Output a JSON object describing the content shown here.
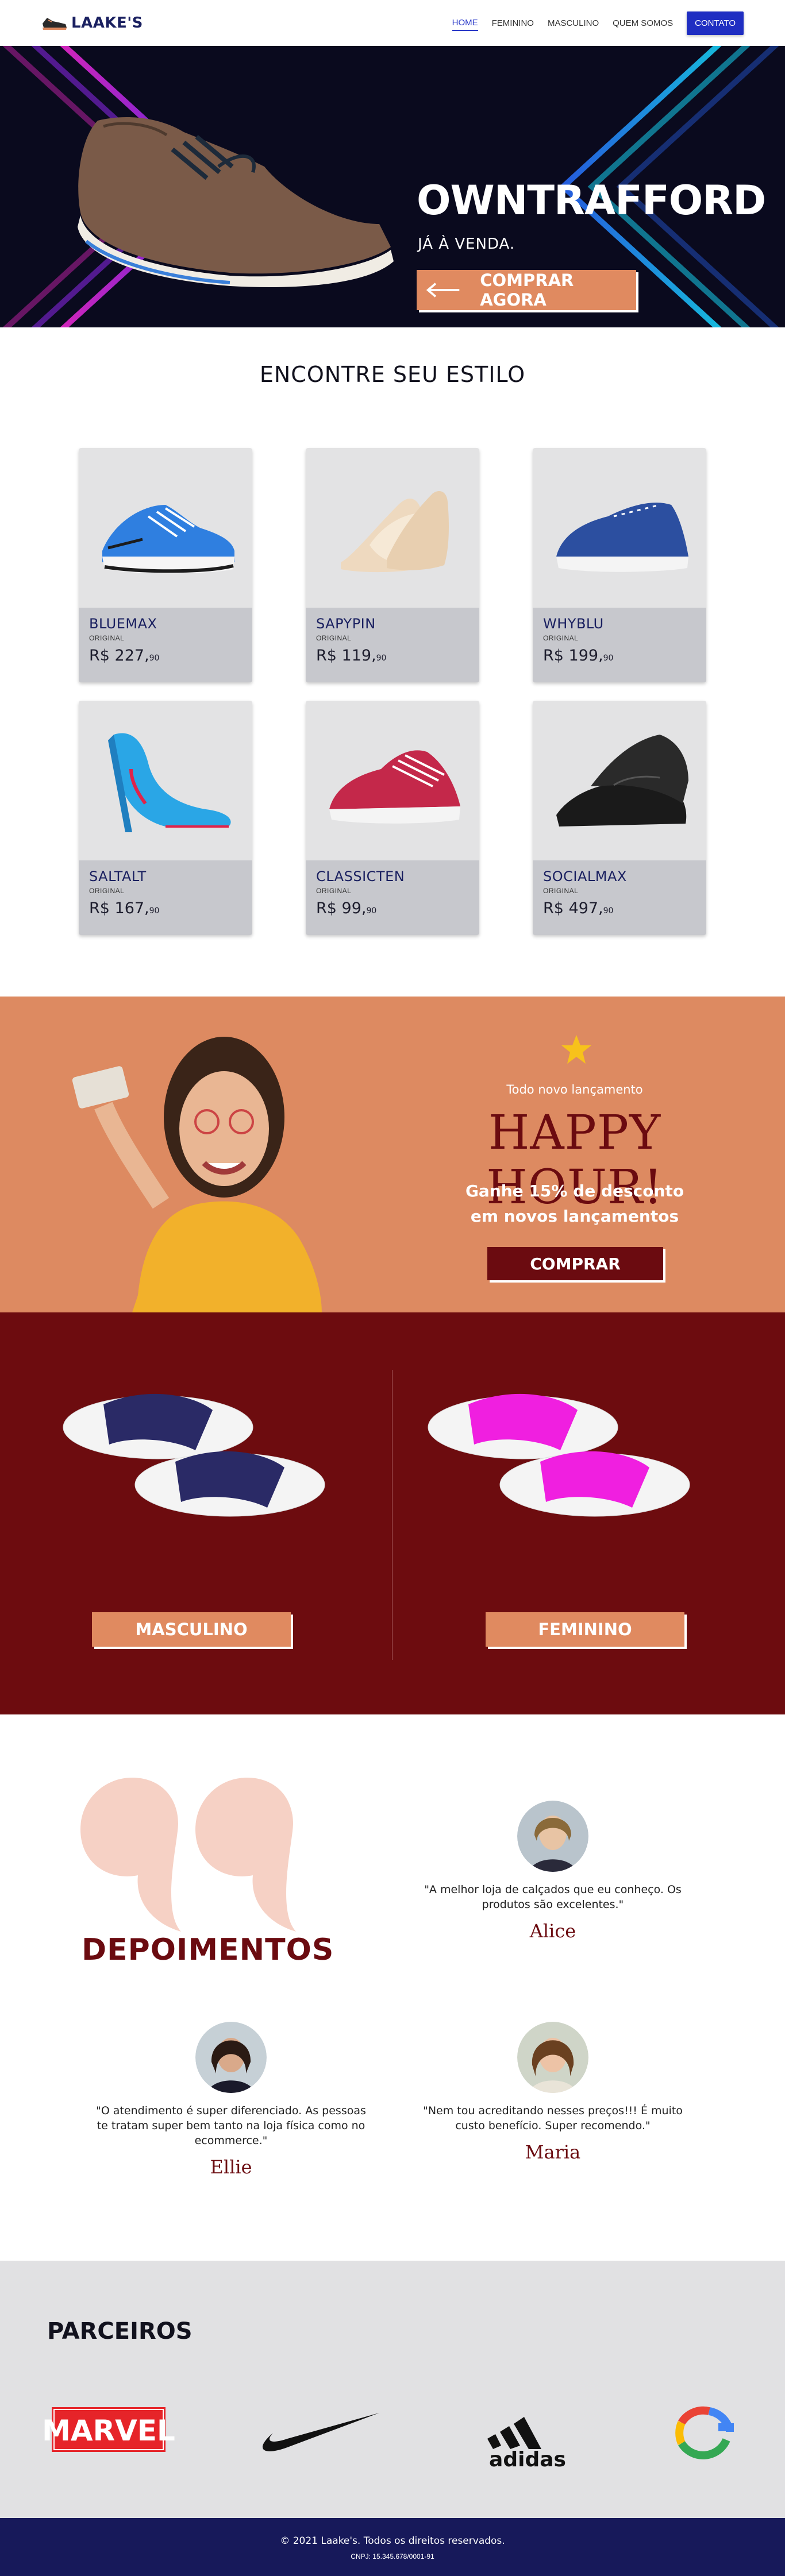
{
  "brand": {
    "name": "LAAKE'S",
    "logo_icon": "sneaker-logo-icon"
  },
  "nav": {
    "links": [
      {
        "label": "HOME",
        "active": true
      },
      {
        "label": "FEMININO"
      },
      {
        "label": "MASCULINO"
      },
      {
        "label": "QUEM SOMOS"
      }
    ],
    "contact_label": "CONTATO",
    "accent_color": "#1f2ec2"
  },
  "hero": {
    "title": "OWNTRAFFORD",
    "subtitle": "JÁ À VENDA.",
    "cta_label": "COMPRAR AGORA",
    "cta_icon": "arrow-left-icon",
    "cta_color": "#e08a60"
  },
  "style_section": {
    "title": "ENCONTRE SEU ESTILO",
    "products": [
      {
        "name": "BLUEMAX",
        "tag": "ORIGINAL",
        "price": "R$ 227,",
        "cents": "90",
        "image": "blue-sneaker"
      },
      {
        "name": "SAPYPIN",
        "tag": "ORIGINAL",
        "price": "R$ 119,",
        "cents": "90",
        "image": "beige-flat"
      },
      {
        "name": "WHYBLU",
        "tag": "ORIGINAL",
        "price": "R$ 199,",
        "cents": "90",
        "image": "navy-canvas"
      },
      {
        "name": "SALTALT",
        "tag": "ORIGINAL",
        "price": "R$ 167,",
        "cents": "90",
        "image": "blue-heel"
      },
      {
        "name": "CLASSICTEN",
        "tag": "ORIGINAL",
        "price": "R$ 99,",
        "cents": "90",
        "image": "red-sneaker"
      },
      {
        "name": "SOCIALMAX",
        "tag": "ORIGINAL",
        "price": "R$ 497,",
        "cents": "90",
        "image": "black-dress-shoe"
      }
    ]
  },
  "promo": {
    "kicker": "Todo novo lançamento",
    "title": "HAPPY HOUR!",
    "desc_line1": "Ganhe 15% de desconto",
    "desc_line2": "em novos lançamentos",
    "cta_label": "COMPRAR",
    "star_icon": "star-icon",
    "bg_color": "#dd8a61"
  },
  "category": {
    "left_label": "MASCULINO",
    "right_label": "FEMININO",
    "bg_color": "#6d0c0f"
  },
  "testimonials": {
    "title": "DEPOIMENTOS",
    "items": [
      {
        "text_line1": "\"A melhor loja de calçados que eu conheço. Os",
        "text_line2": "produtos são excelentes.\"",
        "text_line3": "",
        "name": "Alice"
      },
      {
        "text_line1": "\"O atendimento é super diferenciado. As pessoas",
        "text_line2": "te tratam super bem tanto na loja física como no",
        "text_line3": "ecommerce.\"",
        "name": "Ellie"
      },
      {
        "text_line1": "\"Nem tou acreditando nesses preços!!! É muito",
        "text_line2": "custo benefício. Super recomendo.\"",
        "text_line3": "",
        "name": "Maria"
      }
    ]
  },
  "partners": {
    "title": "PARCEIROS",
    "logos": [
      "MARVEL",
      "nike-swoosh-icon",
      "adidas",
      "google-g-icon"
    ]
  },
  "footer": {
    "copyright": "© 2021 Laake's. Todos os direitos reservados.",
    "cnpj": "CNPJ: 15.345.678/0001-91"
  }
}
